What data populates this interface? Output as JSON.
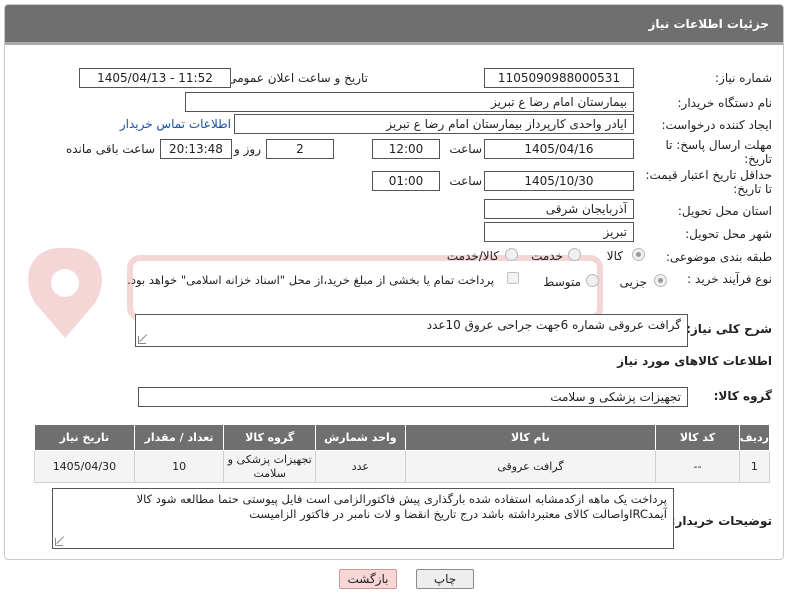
{
  "header": {
    "title": "جزئیات اطلاعات نیاز"
  },
  "fields": {
    "need_number": {
      "label": "شماره نیاز:",
      "value": "1105090988000531"
    },
    "announce_datetime": {
      "label": "تاریخ و ساعت اعلان عمومی:",
      "value": "1405/04/13 - 11:52"
    },
    "buyer_org": {
      "label": "نام دستگاه خریدار:",
      "value": "بیمارستان امام رضا  ع  تبریز"
    },
    "requester": {
      "label": "ایجاد کننده درخواست:",
      "value": "ایادر واحدی کارپرداز بیمارستان امام رضا  ع  تبریز",
      "contact_link": "اطلاعات تماس خریدار"
    },
    "reply_deadline": {
      "label_line1": "مهلت ارسال پاسخ: تا",
      "label_line2": "تاریخ:",
      "date": "1405/04/16",
      "time_label": "ساعت",
      "time": "12:00",
      "days": "2",
      "days_label": "روز و",
      "remaining": "20:13:48",
      "remaining_label": "ساعت باقی مانده"
    },
    "price_validity": {
      "label_line1": "حداقل تاریخ اعتبار قیمت:",
      "label_line2": "تا تاریخ:",
      "date": "1405/10/30",
      "time_label": "ساعت",
      "time": "01:00"
    },
    "delivery_province": {
      "label": "استان محل تحویل:",
      "value": "آذربایجان شرقی"
    },
    "delivery_city": {
      "label": "شهر محل تحویل:",
      "value": "تبریز"
    },
    "category": {
      "label": "طبقه بندی موضوعی:",
      "options": [
        "کالا",
        "خدمت",
        "کالا/خدمت"
      ],
      "selected": "کالا"
    },
    "process": {
      "label": "نوع فرآیند خرید :",
      "options": [
        "جزیی",
        "متوسط"
      ],
      "selected": "جزیی",
      "payment_note": "پرداخت تمام یا بخشی از مبلغ خرید،از محل \"اسناد خزانه اسلامی\" خواهد بود."
    }
  },
  "description": {
    "label": "شرح کلی نیاز:",
    "value": "گرافت عروقی شماره 6جهت جراحی عروق 10عدد"
  },
  "goods_info": {
    "title": "اطلاعات کالاهای مورد نیاز",
    "group_label": "گروه کالا:",
    "group_value": "تجهیزات پزشکی و سلامت"
  },
  "table": {
    "headers": [
      "ردیف",
      "کد کالا",
      "نام کالا",
      "واحد شمارش",
      "گروه کالا",
      "تعداد / مقدار",
      "تاریخ نیاز"
    ],
    "rows": [
      {
        "row": "1",
        "code": "--",
        "name": "گرافت عروقی",
        "unit": "عدد",
        "group_line1": "تجهیزات پزشکی و",
        "group_line2": "سلامت",
        "qty": "10",
        "date": "1405/04/30"
      }
    ]
  },
  "buyer_notes": {
    "label": "توضیحات خریدار:",
    "line1": "پرداخت یک ماهه ازکدمشابه استفاده شده بارگذاری پیش فاکتورالزامی است فایل پیوستی حتما مطالعه شود کالا",
    "line2": "آیمدIRCواصالت کالای معتبرداشته باشد درج تاریخ انقضا و لات نامبر در فاکتور الزامیست"
  },
  "buttons": {
    "print": "چاپ",
    "back": "بازگشت"
  },
  "colors": {
    "header_bg": "#6f6f6f",
    "link": "#1a4fa0",
    "back_button": "#f8d6d6"
  }
}
